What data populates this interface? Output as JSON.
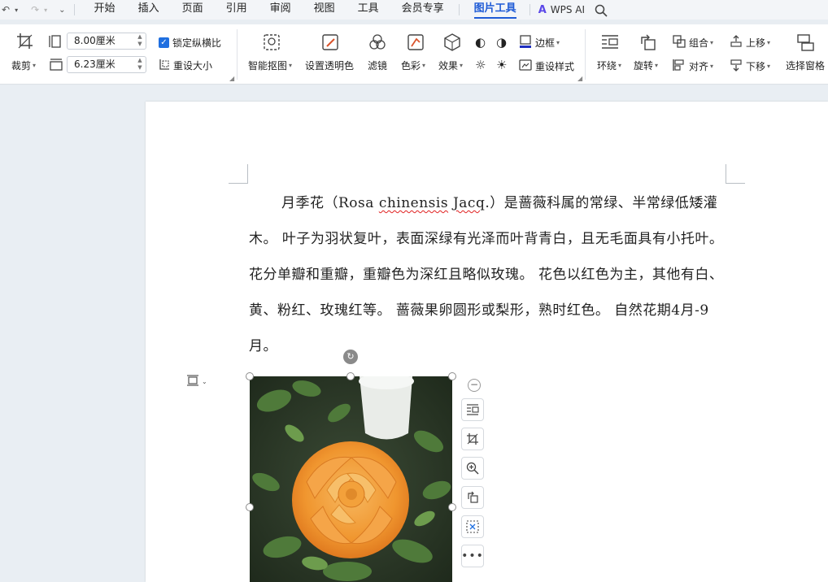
{
  "menubar": {
    "tabs": [
      {
        "label": "开始"
      },
      {
        "label": "插入"
      },
      {
        "label": "页面"
      },
      {
        "label": "引用"
      },
      {
        "label": "审阅"
      },
      {
        "label": "视图"
      },
      {
        "label": "工具"
      },
      {
        "label": "会员专享"
      },
      {
        "label": "图片工具",
        "active": true
      }
    ],
    "wps_ai_label": "WPS AI"
  },
  "ribbon": {
    "crop_label": "裁剪",
    "height_value": "8.00厘米",
    "width_value": "6.23厘米",
    "lock_ratio_label": "锁定纵横比",
    "reset_size_label": "重设大小",
    "smart_cutout_label": "智能抠图",
    "set_transparent_label": "设置透明色",
    "filter_label": "滤镜",
    "color_label": "色彩",
    "effects_label": "效果",
    "border_label": "边框",
    "reset_style_label": "重设样式",
    "wrap_label": "环绕",
    "rotate_label": "旋转",
    "group_label": "组合",
    "align_label": "对齐",
    "bring_forward_label": "上移",
    "send_backward_label": "下移",
    "selection_pane_label": "选择窗格"
  },
  "document": {
    "para_before": "月季花（Rosa ",
    "para_species": "chinensis",
    "para_space": " ",
    "para_author": "Jacq",
    "para_after": ".）是蔷薇科属的常绿、半常绿低矮灌木。 叶子为羽状复叶，表面深绿有光泽而叶背青白，且无毛面具有小托叶。 花分单瓣和重瓣，重瓣色为深红且略似玫瑰。 花色以红色为主，其他有白、黄、粉红、玫瑰红等。 蔷薇果卵圆形或梨形，熟时红色。 自然花期4月-9月。"
  },
  "colors": {
    "accent": "#1f5bd6",
    "spell_error": "#e02020"
  }
}
